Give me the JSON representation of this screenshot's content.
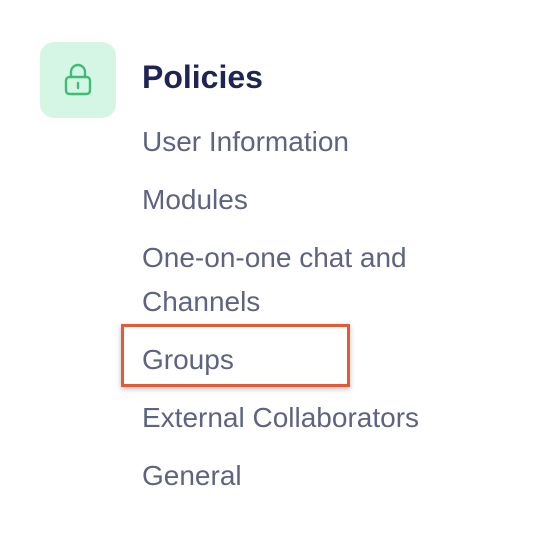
{
  "section": {
    "icon": "lock-icon",
    "icon_color": "#3dbd76",
    "tile_color": "#d5f6e4",
    "title": "Policies"
  },
  "nav": {
    "items": [
      {
        "label": "User Information"
      },
      {
        "label": "Modules"
      },
      {
        "label": "One-on-one chat and Channels"
      },
      {
        "label": "Groups",
        "highlighted": true
      },
      {
        "label": "External Collaborators"
      },
      {
        "label": "General"
      }
    ]
  },
  "colors": {
    "title": "#1e2454",
    "item": "#5f6381",
    "highlight_border": "#e45a36"
  }
}
